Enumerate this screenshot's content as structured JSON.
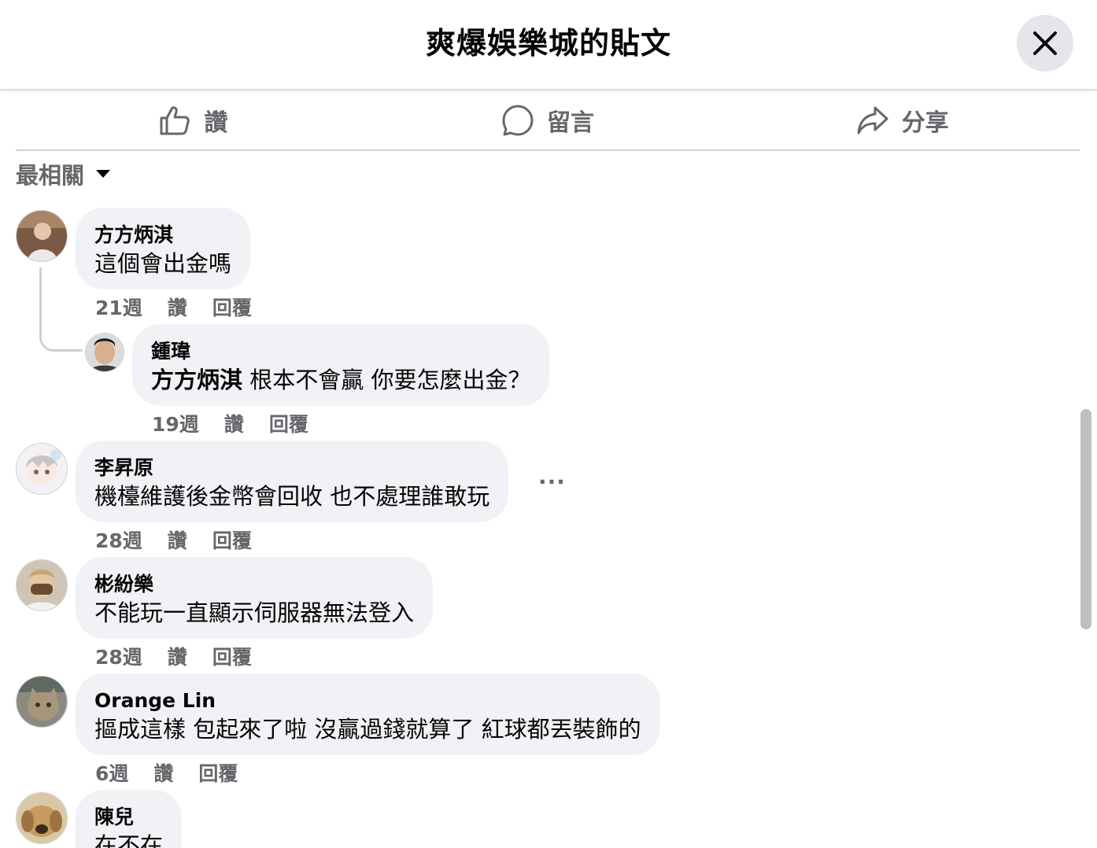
{
  "header": {
    "title": "爽爆娛樂城的貼文",
    "close_icon": "close-icon"
  },
  "actions": [
    {
      "label": "讚",
      "icon": "thumbs-up-icon"
    },
    {
      "label": "留言",
      "icon": "comment-bubble-icon"
    },
    {
      "label": "分享",
      "icon": "share-arrow-icon"
    }
  ],
  "sort": {
    "label": "最相關",
    "icon": "caret-down-icon"
  },
  "comments": [
    {
      "name": "方方炳淇",
      "text": "這個會出金嗎",
      "time": "21週",
      "like": "讚",
      "reply": "回覆"
    },
    {
      "name": "鍾瑋",
      "mention": "方方炳淇",
      "text": " 根本不會贏 你要怎麼出金？",
      "time": "19週",
      "like": "讚",
      "reply": "回覆"
    },
    {
      "name": "李昇原",
      "text": "機檯維護後金幣會回收 也不處理誰敢玩",
      "time": "28週",
      "like": "讚",
      "reply": "回覆",
      "more": "···"
    },
    {
      "name": "彬紛樂",
      "text": "不能玩一直顯示伺服器無法登入",
      "time": "28週",
      "like": "讚",
      "reply": "回覆"
    },
    {
      "name": "Orange Lin",
      "text": "摳成這樣 包起來了啦 沒贏過錢就算了 紅球都丟裝飾的",
      "time": "6週",
      "like": "讚",
      "reply": "回覆"
    },
    {
      "name": "陳兒",
      "text": "在不在"
    }
  ],
  "colors": {
    "bubble": "#f0f2f5",
    "secondary_text": "#65676b",
    "divider": "#ced0d4"
  }
}
